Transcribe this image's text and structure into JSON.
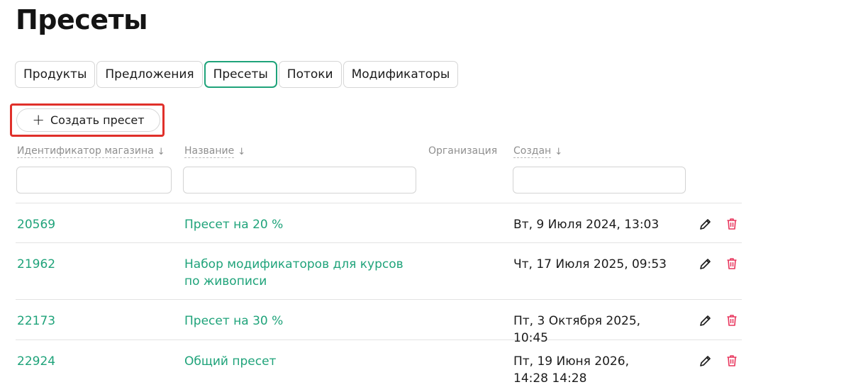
{
  "page": {
    "title": "Пресеты"
  },
  "tabs": [
    {
      "label": "Продукты",
      "active": false
    },
    {
      "label": "Предложения",
      "active": false
    },
    {
      "label": "Пресеты",
      "active": true
    },
    {
      "label": "Потоки",
      "active": false
    },
    {
      "label": "Модификаторы",
      "active": false
    }
  ],
  "toolbar": {
    "create_label": "Создать пресет",
    "create_icon": "plus-icon",
    "highlight_color": "#e0302a"
  },
  "table": {
    "columns": [
      {
        "label": "Идентификатор магазина",
        "sortable": true
      },
      {
        "label": "Название",
        "sortable": true
      },
      {
        "label": "Организация",
        "sortable": false
      },
      {
        "label": "Создан",
        "sortable": true
      }
    ],
    "filters": {
      "store_id": "",
      "name": "",
      "created": ""
    },
    "rows": [
      {
        "id": "20569",
        "name": "Пресет на 20 %",
        "organization": "",
        "created": "Вт, 9 Июля 2024, 13:03"
      },
      {
        "id": "21962",
        "name": "Набор модификаторов для курсов по живописи",
        "organization": "",
        "created": "Чт, 17 Июля 2025, 09:53"
      },
      {
        "id": "22173",
        "name": "Пресет на 30 %",
        "organization": "",
        "created": "Пт, 3 Октября 2025, 10:45"
      },
      {
        "id": "22924",
        "name": "Общий пресет",
        "organization": "",
        "created": "Пт, 19 Июня 2026, 14:28 14:28"
      }
    ],
    "row_actions": [
      "edit-icon",
      "trash-icon"
    ]
  },
  "colors": {
    "accent": "#1fa37a",
    "danger": "#e8365d",
    "text": "#1b1b1b",
    "muted": "#8f8f8f"
  }
}
